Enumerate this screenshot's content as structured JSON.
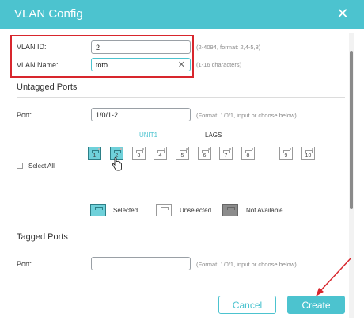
{
  "dialog": {
    "title": "VLAN Config",
    "close_icon": "✕"
  },
  "vlan": {
    "id_label": "VLAN ID:",
    "id_value": "2",
    "id_hint": "(2-4094, format: 2,4-5,8)",
    "name_label": "VLAN Name:",
    "name_value": "toto",
    "name_hint": "(1-16 characters)",
    "clear_icon": "✕"
  },
  "untagged": {
    "title": "Untagged Ports",
    "port_label": "Port:",
    "port_value": "1/0/1-2",
    "port_hint": "(Format: 1/0/1, input or choose below)",
    "unit_label": "UNIT1",
    "lags_label": "LAGS",
    "select_all": "Select All",
    "ports": [
      "1",
      "2",
      "3",
      "4",
      "5",
      "6",
      "7",
      "8",
      "9",
      "10"
    ],
    "selected_ports": [
      "1",
      "2"
    ]
  },
  "legend": {
    "selected": "Selected",
    "unselected": "Unselected",
    "not_available": "Not Available"
  },
  "tagged": {
    "title": "Tagged Ports",
    "port_label": "Port:",
    "port_value": "",
    "port_hint": "(Format: 1/0/1, input or choose below)"
  },
  "buttons": {
    "cancel": "Cancel",
    "create": "Create"
  },
  "colors": {
    "accent": "#4cc3cf",
    "highlight": "#d8262d",
    "arrow": "#d8262d",
    "not_available": "#8c8c8c"
  }
}
